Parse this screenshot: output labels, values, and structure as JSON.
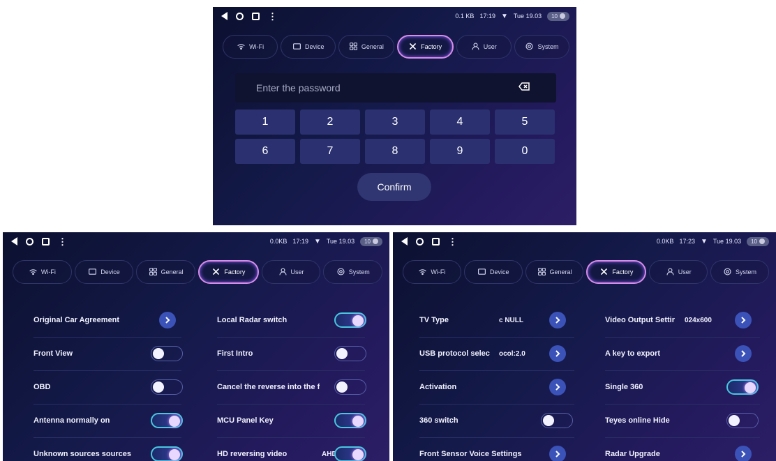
{
  "colors": {
    "accent_ring": "#d88de8",
    "toggle_on": "#49c7e0",
    "arrow_button": "#3b52b8",
    "keypad_key": "#2a3070"
  },
  "tabs": [
    {
      "label": "Wi-Fi",
      "icon": "wifi-icon"
    },
    {
      "label": "Device",
      "icon": "device-icon"
    },
    {
      "label": "General",
      "icon": "general-grid-icon"
    },
    {
      "label": "Factory",
      "icon": "factory-tools-icon",
      "active": true
    },
    {
      "label": "User",
      "icon": "user-icon"
    },
    {
      "label": "System",
      "icon": "system-gear-icon"
    }
  ],
  "screens": [
    {
      "status": {
        "speed": "0.1 KB",
        "time": "17:19",
        "date": "Tue 19.03",
        "volume": "10"
      },
      "password": {
        "placeholder": "Enter the password",
        "backspace_icon": "backspace-icon"
      },
      "keypad": [
        "1",
        "2",
        "3",
        "4",
        "5",
        "6",
        "7",
        "8",
        "9",
        "0"
      ],
      "confirm_label": "Confirm"
    },
    {
      "status": {
        "speed": "0.0KB",
        "time": "17:19",
        "date": "Tue 19.03",
        "volume": "10"
      },
      "left_items": [
        {
          "label": "Original Car Agreement",
          "control": "arrow"
        },
        {
          "label": "Front View",
          "control": "toggle",
          "state": "off"
        },
        {
          "label": "OBD",
          "control": "toggle",
          "state": "off"
        },
        {
          "label": "Antenna normally on",
          "control": "toggle",
          "state": "on"
        },
        {
          "label": "Unknown sources sources",
          "control": "toggle",
          "state": "on"
        }
      ],
      "right_items": [
        {
          "label": "Local Radar switch",
          "control": "toggle",
          "state": "on"
        },
        {
          "label": "First Intro",
          "control": "toggle",
          "state": "off"
        },
        {
          "label": "Cancel the reverse into the f",
          "control": "toggle",
          "state": "off"
        },
        {
          "label": "MCU Panel Key",
          "control": "toggle",
          "state": "on"
        },
        {
          "label": "HD reversing video",
          "value": "AHD",
          "control": "toggle",
          "state": "on"
        }
      ]
    },
    {
      "status": {
        "speed": "0.0KB",
        "time": "17:23",
        "date": "Tue 19.03",
        "volume": "10"
      },
      "left_items": [
        {
          "label": "TV Type",
          "value": "c NULL",
          "control": "arrow"
        },
        {
          "label": "USB protocol selec",
          "value": "ocol:2.0",
          "control": "arrow"
        },
        {
          "label": "Activation",
          "control": "arrow"
        },
        {
          "label": "360 switch",
          "control": "toggle",
          "state": "off"
        },
        {
          "label": "Front Sensor Voice Settings",
          "control": "arrow"
        }
      ],
      "right_items": [
        {
          "label": "Video Output Settir",
          "value": "024x600",
          "control": "arrow"
        },
        {
          "label": "A key to export",
          "control": "arrow"
        },
        {
          "label": "Single 360",
          "control": "toggle",
          "state": "on"
        },
        {
          "label": "Teyes online Hide",
          "control": "toggle",
          "state": "off"
        },
        {
          "label": "Radar Upgrade",
          "control": "arrow"
        }
      ]
    }
  ]
}
